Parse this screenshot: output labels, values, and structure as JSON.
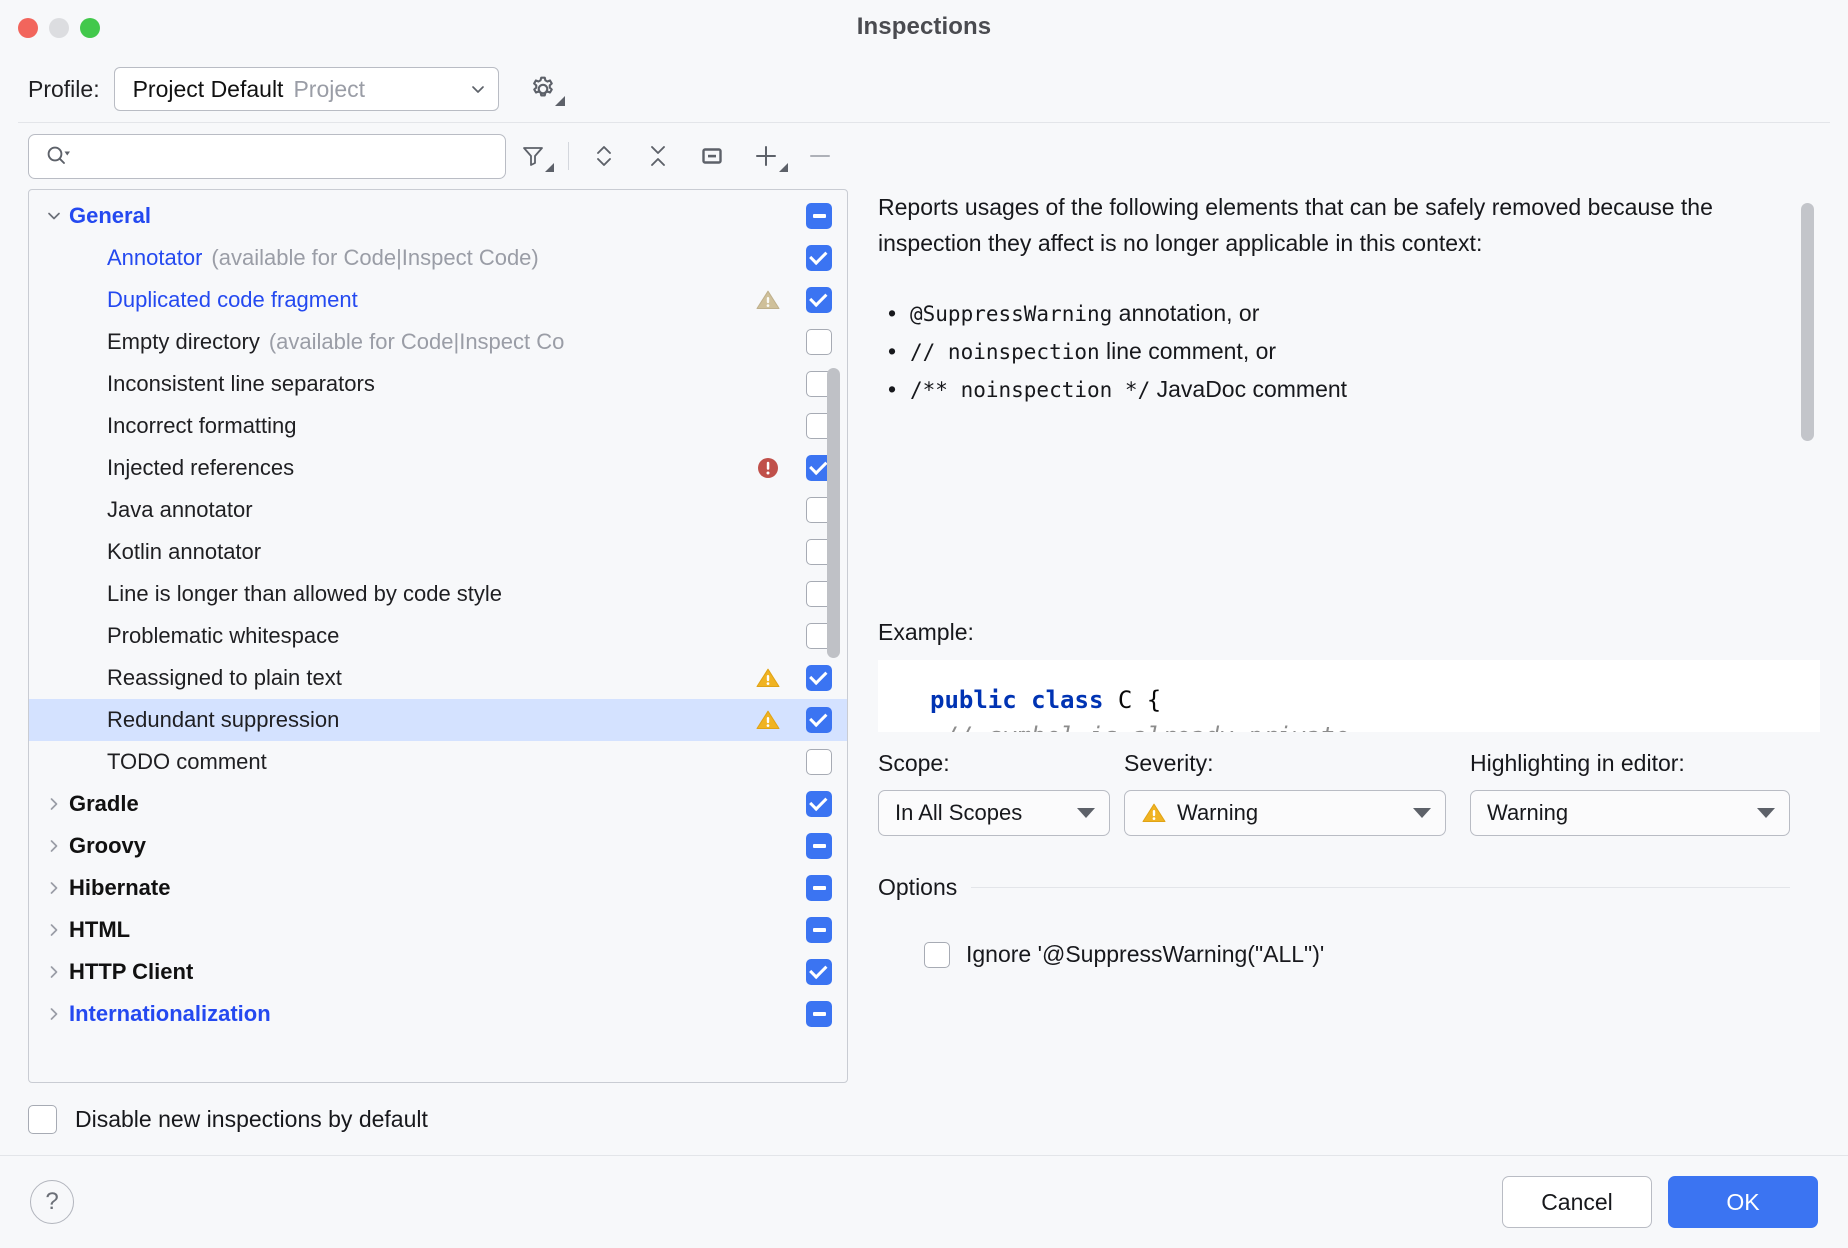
{
  "window": {
    "title": "Inspections",
    "controls": [
      "close-button",
      "minimize-button",
      "zoom-button"
    ]
  },
  "profile_row": {
    "label": "Profile:",
    "selected_name": "Project Default",
    "selected_scope": "Project",
    "gear_icon": "gear-icon",
    "chevron_icon": "chevron-down-icon"
  },
  "search": {
    "value": "",
    "placeholder": "",
    "icon": "search-icon"
  },
  "toolbar": {
    "items": [
      {
        "name": "filter-icon",
        "tooltip": "Filter"
      },
      {
        "name": "expand-all-icon",
        "tooltip": "Expand All"
      },
      {
        "name": "collapse-all-icon",
        "tooltip": "Collapse All"
      },
      {
        "name": "show-only-enabled-icon",
        "tooltip": "Show Only Enabled"
      },
      {
        "name": "add-icon",
        "tooltip": "Add Scope"
      },
      {
        "name": "remove-icon",
        "tooltip": "Remove Scope"
      }
    ]
  },
  "tree": {
    "rows": [
      {
        "label": "General",
        "suffix": "",
        "style": "groupblue",
        "twisty": "down",
        "check": "part",
        "severity": "",
        "selected": false,
        "level": 0
      },
      {
        "label": "Annotator",
        "suffix": "(available for Code|Inspect Code)",
        "style": "blue",
        "twisty": "",
        "check": "on",
        "severity": "",
        "selected": false,
        "level": 1
      },
      {
        "label": "Duplicated code fragment",
        "suffix": "",
        "style": "blue",
        "twisty": "",
        "check": "on",
        "severity": "warning-muted",
        "selected": false,
        "level": 1
      },
      {
        "label": "Empty directory",
        "suffix": "(available for Code|Inspect Co",
        "style": "plain",
        "twisty": "",
        "check": "off",
        "severity": "",
        "selected": false,
        "level": 1
      },
      {
        "label": "Inconsistent line separators",
        "suffix": "",
        "style": "plain",
        "twisty": "",
        "check": "off",
        "severity": "",
        "selected": false,
        "level": 1
      },
      {
        "label": "Incorrect formatting",
        "suffix": "",
        "style": "plain",
        "twisty": "",
        "check": "off",
        "severity": "",
        "selected": false,
        "level": 1
      },
      {
        "label": "Injected references",
        "suffix": "",
        "style": "plain",
        "twisty": "",
        "check": "on",
        "severity": "error",
        "selected": false,
        "level": 1
      },
      {
        "label": "Java annotator",
        "suffix": "",
        "style": "plain",
        "twisty": "",
        "check": "off",
        "severity": "",
        "selected": false,
        "level": 1
      },
      {
        "label": "Kotlin annotator",
        "suffix": "",
        "style": "plain",
        "twisty": "",
        "check": "off",
        "severity": "",
        "selected": false,
        "level": 1
      },
      {
        "label": "Line is longer than allowed by code style",
        "suffix": "",
        "style": "plain",
        "twisty": "",
        "check": "off",
        "severity": "",
        "selected": false,
        "level": 1
      },
      {
        "label": "Problematic whitespace",
        "suffix": "",
        "style": "plain",
        "twisty": "",
        "check": "off",
        "severity": "",
        "selected": false,
        "level": 1
      },
      {
        "label": "Reassigned to plain text",
        "suffix": "",
        "style": "plain",
        "twisty": "",
        "check": "on",
        "severity": "warning",
        "selected": false,
        "level": 1
      },
      {
        "label": "Redundant suppression",
        "suffix": "",
        "style": "plain",
        "twisty": "",
        "check": "on",
        "severity": "warning",
        "selected": true,
        "level": 1
      },
      {
        "label": "TODO comment",
        "suffix": "",
        "style": "plain",
        "twisty": "",
        "check": "off",
        "severity": "",
        "selected": false,
        "level": 1
      },
      {
        "label": "Gradle",
        "suffix": "",
        "style": "group",
        "twisty": "right",
        "check": "on",
        "severity": "",
        "selected": false,
        "level": 0
      },
      {
        "label": "Groovy",
        "suffix": "",
        "style": "group",
        "twisty": "right",
        "check": "part",
        "severity": "",
        "selected": false,
        "level": 0
      },
      {
        "label": "Hibernate",
        "suffix": "",
        "style": "group",
        "twisty": "right",
        "check": "part",
        "severity": "",
        "selected": false,
        "level": 0
      },
      {
        "label": "HTML",
        "suffix": "",
        "style": "group",
        "twisty": "right",
        "check": "part",
        "severity": "",
        "selected": false,
        "level": 0
      },
      {
        "label": "HTTP Client",
        "suffix": "",
        "style": "group",
        "twisty": "right",
        "check": "on",
        "severity": "",
        "selected": false,
        "level": 0
      },
      {
        "label": "Internationalization",
        "suffix": "",
        "style": "groupblue",
        "twisty": "right",
        "check": "part",
        "severity": "",
        "selected": false,
        "level": 0
      }
    ]
  },
  "description": {
    "intro": "Reports usages of the following elements that can be safely removed because the inspection they affect is no longer applicable in this context:",
    "bullets": [
      {
        "code": "@SuppressWarning",
        "rest": " annotation, or"
      },
      {
        "code": "// noinspection",
        "rest": " line comment, or"
      },
      {
        "code": "/** noinspection */",
        "rest": " JavaDoc comment"
      }
    ],
    "example_label": "Example:",
    "code_lines": [
      {
        "kw": "public class",
        "plain": " C {"
      },
      {
        "comment": " // symbol is already private,"
      }
    ]
  },
  "selectors": {
    "scope": {
      "label": "Scope:",
      "value": "In All Scopes"
    },
    "severity": {
      "label": "Severity:",
      "value": "Warning",
      "icon": "warning-triangle-icon"
    },
    "highlighting": {
      "label": "Highlighting in editor:",
      "value": "Warning"
    }
  },
  "options": {
    "title": "Options",
    "items": [
      {
        "label": "Ignore '@SuppressWarning(\"ALL\")'",
        "checked": false
      }
    ]
  },
  "bottom": {
    "disable_new_label": "Disable new inspections by default",
    "disable_new_checked": false
  },
  "footer": {
    "help_label": "?",
    "cancel_label": "Cancel",
    "ok_label": "OK"
  },
  "colors": {
    "accent_blue": "#3b74f2",
    "link_blue": "#2449f0",
    "selection_blue": "#d4e2ff",
    "warning_yellow": "#f0b322",
    "warning_muted": "#cfc09a",
    "error_red": "#c0504a",
    "window_bg": "#f7f8fa"
  }
}
